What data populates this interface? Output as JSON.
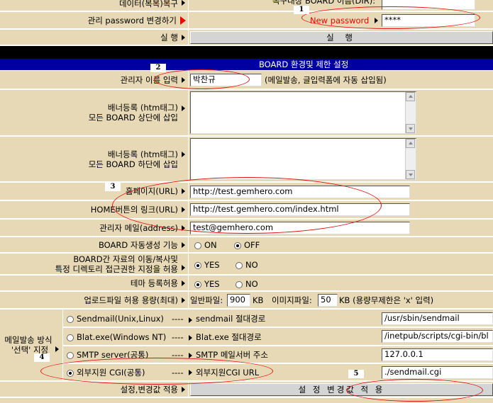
{
  "rows": {
    "restore_data": {
      "label": "데이터(복복)복구",
      "target_label": "복구대상 BOARD 이름(DIR):"
    },
    "admin_password": {
      "label": "관리 password 변경하기",
      "new_password_label": "New password",
      "password_value": "****"
    },
    "execute_top": {
      "label": "실 행",
      "button": "실 행"
    },
    "section_title": "BOARD  환경및 제한 설정",
    "admin_name": {
      "label": "관리자 이름 입력",
      "value": "박찬규",
      "note": "(메일발송, 글입력폼에 자동 삽입됨)"
    },
    "banner_top": {
      "label_line1": "배너등록 (htm태그)",
      "label_line2": "모든 BOARD 상단에 삽입"
    },
    "banner_bottom": {
      "label_line1": "배너등록 (htm태그)",
      "label_line2": "모든 BOARD 하단에 삽입"
    },
    "homepage": {
      "label": "홈페이지(URL)",
      "value": "http://test.gemhero.com"
    },
    "home_button_link": {
      "label": "HOME버튼의 링크(URL)",
      "value": "http://test.gemhero.com/index.html"
    },
    "admin_email": {
      "label": "관리자 메일(address)",
      "value": "test@gemhero.com"
    },
    "auto_create": {
      "label": "BOARD 자동생성 기능",
      "on": "ON",
      "off": "OFF"
    },
    "move_copy": {
      "label_line1": "BOARD간 자료의 이동/복사및",
      "label_line2": "특정 디렉토리 접근권한 지정을 허용",
      "yes": "YES",
      "no": "NO"
    },
    "theme": {
      "label": "테마 등록허용",
      "yes": "YES",
      "no": "NO"
    },
    "upload": {
      "label": "업로드파일 허용 용량(최대)",
      "general": "일반파일:",
      "general_value": "900",
      "kb1": "KB",
      "image": "이미지파일:",
      "image_value": "50",
      "kb2": "KB (용량무제한은 'x' 입력)"
    },
    "mail": {
      "label_line1": "메일발송 방식",
      "label_line2": "'선택' 지정",
      "options": [
        {
          "name": "Sendmail(Unix,Linux)",
          "arrow": "----",
          "path_label": "sendmail 절대경로",
          "value": "/usr/sbin/sendmail"
        },
        {
          "name": "Blat.exe(Windows NT)",
          "arrow": "----",
          "path_label": "Blat.exe 절대경로",
          "value": "/inetpub/scripts/cgi-bin/bl"
        },
        {
          "name": "SMTP server(공통)",
          "arrow": "----",
          "path_label": "SMTP 메일서버 주소",
          "value": "127.0.0.1"
        },
        {
          "name": "외부지원 CGI(공통)",
          "arrow": "----",
          "path_label": "외부지원CGI URL",
          "value": "./sendmail.cgi"
        }
      ]
    },
    "apply": {
      "label": "설정,변경값 적용",
      "button": "설 정  변경값 적 용"
    }
  },
  "annotations": [
    "1",
    "2",
    "3",
    "4",
    "5"
  ],
  "colors": {
    "label_bg": "#E8D9B6",
    "section_bar": "#0000A0",
    "black_bar": "#000000",
    "annotation": "#E01010"
  }
}
